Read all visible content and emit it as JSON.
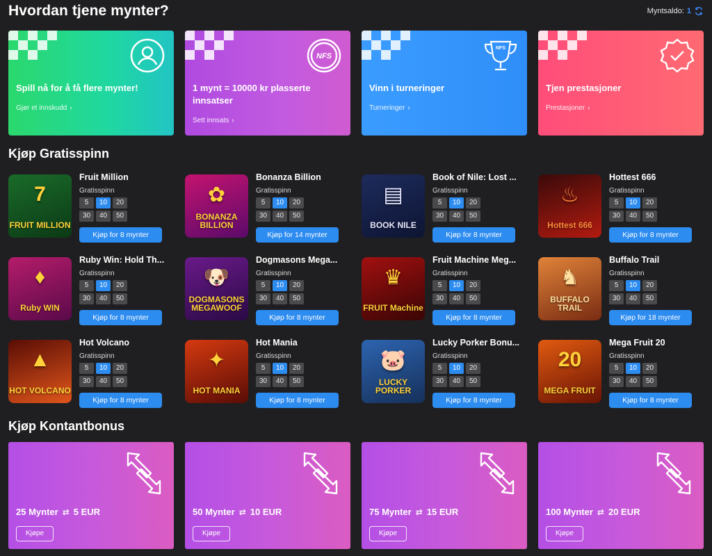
{
  "header": {
    "title": "Hvordan tjene mynter?",
    "balance_label": "Myntsaldo:",
    "balance_value": "1"
  },
  "earn_cards": [
    {
      "title": "Spill nå for å få flere mynter!",
      "link": "Gjør et innskudd",
      "icon": "user-icon",
      "color": "#2bd86d"
    },
    {
      "title": "1 mynt = 10000 kr plasserte innsatser",
      "link": "Sett innsats",
      "icon": "nfs-badge-icon",
      "color": "#b04ae0"
    },
    {
      "title": "Vinn i turneringer",
      "link": "Turneringer",
      "icon": "trophy-icon",
      "color": "#3b9cff"
    },
    {
      "title": "Tjen prestasjoner",
      "link": "Prestasjoner",
      "icon": "achievement-badge-icon",
      "color": "#ff4d7a"
    }
  ],
  "spins": {
    "heading": "Kjøp Gratisspinn",
    "sub_label": "Gratisspinn",
    "options": [
      "5",
      "10",
      "20",
      "30",
      "40",
      "50"
    ],
    "selected": "10",
    "games": [
      {
        "name": "Fruit Million",
        "buy": "Kjøp for 8 mynter",
        "thumb_text": "FRUIT MILLION",
        "emblem": "7"
      },
      {
        "name": "Bonanza Billion",
        "buy": "Kjøp for 14 mynter",
        "thumb_text": "BONANZA BILLION",
        "emblem": "✿"
      },
      {
        "name": "Book of Nile: Lost ...",
        "buy": "Kjøp for 8 mynter",
        "thumb_text": "BOOK NILE",
        "emblem": "▤"
      },
      {
        "name": "Hottest 666",
        "buy": "Kjøp for 8 mynter",
        "thumb_text": "Hottest 666",
        "emblem": "♨"
      },
      {
        "name": "Ruby Win: Hold Th...",
        "buy": "Kjøp for 8 mynter",
        "thumb_text": "Ruby WIN",
        "emblem": "♦"
      },
      {
        "name": "Dogmasons Mega...",
        "buy": "Kjøp for 8 mynter",
        "thumb_text": "DOGMASONS MEGAWOOF",
        "emblem": "🐶"
      },
      {
        "name": "Fruit Machine Meg...",
        "buy": "Kjøp for 8 mynter",
        "thumb_text": "FRUIT Machine",
        "emblem": "♛"
      },
      {
        "name": "Buffalo Trail",
        "buy": "Kjøp for 18 mynter",
        "thumb_text": "BUFFALO TRAIL",
        "emblem": "♞"
      },
      {
        "name": "Hot Volcano",
        "buy": "Kjøp for 8 mynter",
        "thumb_text": "HOT VOLCANO",
        "emblem": "▲"
      },
      {
        "name": "Hot Mania",
        "buy": "Kjøp for 8 mynter",
        "thumb_text": "HOT MANIA",
        "emblem": "✦"
      },
      {
        "name": "Lucky Porker Bonu...",
        "buy": "Kjøp for 8 mynter",
        "thumb_text": "LUCKY PORKER",
        "emblem": "🐷"
      },
      {
        "name": "Mega Fruit 20",
        "buy": "Kjøp for 8 mynter",
        "thumb_text": "MEGA FRUIT",
        "emblem": "20"
      }
    ]
  },
  "cash": {
    "heading": "Kjøp Kontantbonus",
    "button": "Kjøpe",
    "swap_glyph": "⇄",
    "items": [
      {
        "coins": "25 Mynter",
        "amount": "5 EUR"
      },
      {
        "coins": "50 Mynter",
        "amount": "10 EUR"
      },
      {
        "coins": "75 Mynter",
        "amount": "15 EUR"
      },
      {
        "coins": "100 Mynter",
        "amount": "20 EUR"
      }
    ]
  }
}
